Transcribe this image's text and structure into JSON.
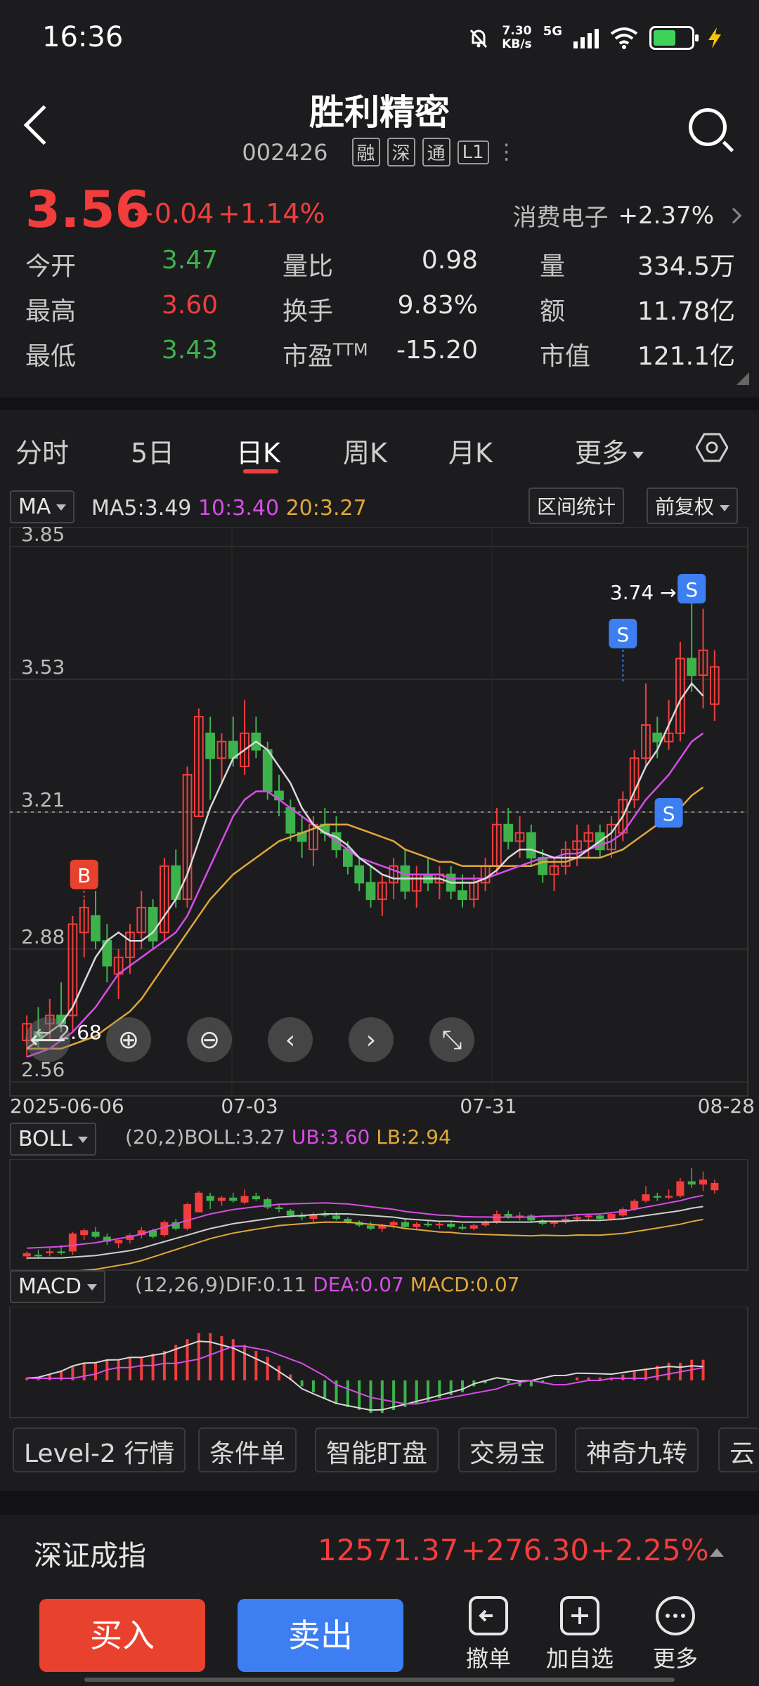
{
  "status_bar": {
    "time": "16:36",
    "net_speed": "7.30",
    "net_unit": "KB/s",
    "network": "5G"
  },
  "header": {
    "title": "胜利精密",
    "code": "002426",
    "tags": [
      "融",
      "深",
      "通",
      "L1"
    ]
  },
  "quote": {
    "price": "3.56",
    "change": "+0.04",
    "change_pct": "+1.14%",
    "sector_name": "消费电子",
    "sector_change": "+2.37%",
    "rows": [
      [
        {
          "label": "今开",
          "value": "3.47",
          "color": "green"
        },
        {
          "label": "量比",
          "value": "0.98",
          "color": "white"
        },
        {
          "label": "量",
          "value": "334.5万",
          "color": "white"
        }
      ],
      [
        {
          "label": "最高",
          "value": "3.60",
          "color": "red"
        },
        {
          "label": "换手",
          "value": "9.83%",
          "color": "white"
        },
        {
          "label": "额",
          "value": "11.78亿",
          "color": "white"
        }
      ],
      [
        {
          "label": "最低",
          "value": "3.43",
          "color": "green"
        },
        {
          "label": "市盈TTM",
          "value": "-15.20",
          "color": "white"
        },
        {
          "label": "市值",
          "value": "121.1亿",
          "color": "white"
        }
      ]
    ],
    "pe_label_main": "市盈",
    "pe_label_sup": "TTM"
  },
  "tabs": {
    "items": [
      "分时",
      "5日",
      "日K",
      "周K",
      "月K"
    ],
    "active": "日K",
    "more": "更多"
  },
  "ma_bar": {
    "indicator": "MA",
    "ma5": "MA5:3.49",
    "ma10": "10:3.40",
    "ma20": "20:3.27",
    "range_stats": "区间统计",
    "adjust": "前复权"
  },
  "colors": {
    "up": "#f23d3d",
    "down": "#3db24b",
    "ma5": "#d9d9d9",
    "ma10": "#d64ee6",
    "ma20": "#e0a83a",
    "accent": "#3d7ef2"
  },
  "chart_data": {
    "type": "candlestick",
    "y_ticks": [
      "3.85",
      "3.53",
      "3.21",
      "2.88",
      "2.56"
    ],
    "ylim": [
      2.56,
      3.85
    ],
    "x_ticks": [
      "2025-06-06",
      "07-03",
      "07-31",
      "08-28"
    ],
    "high_marker": "3.74",
    "low_marker": "2.68",
    "reference_line": 3.21,
    "markers": [
      {
        "label": "B",
        "index": 5
      },
      {
        "label": "S",
        "index": 52
      },
      {
        "label": "S",
        "index": 58
      },
      {
        "label": "S",
        "index": 57
      }
    ],
    "candles": [
      {
        "o": 2.66,
        "h": 2.72,
        "l": 2.62,
        "c": 2.7
      },
      {
        "o": 2.68,
        "h": 2.74,
        "l": 2.64,
        "c": 2.66
      },
      {
        "o": 2.7,
        "h": 2.76,
        "l": 2.66,
        "c": 2.72
      },
      {
        "o": 2.72,
        "h": 2.8,
        "l": 2.68,
        "c": 2.7
      },
      {
        "o": 2.72,
        "h": 2.96,
        "l": 2.68,
        "c": 2.94
      },
      {
        "o": 2.92,
        "h": 3.0,
        "l": 2.86,
        "c": 2.98
      },
      {
        "o": 2.96,
        "h": 3.02,
        "l": 2.88,
        "c": 2.9
      },
      {
        "o": 2.9,
        "h": 2.94,
        "l": 2.8,
        "c": 2.84
      },
      {
        "o": 2.82,
        "h": 2.88,
        "l": 2.76,
        "c": 2.86
      },
      {
        "o": 2.86,
        "h": 2.94,
        "l": 2.82,
        "c": 2.92
      },
      {
        "o": 2.92,
        "h": 3.02,
        "l": 2.88,
        "c": 2.98
      },
      {
        "o": 2.98,
        "h": 3.0,
        "l": 2.88,
        "c": 2.9
      },
      {
        "o": 2.92,
        "h": 3.1,
        "l": 2.9,
        "c": 3.08
      },
      {
        "o": 3.08,
        "h": 3.12,
        "l": 2.98,
        "c": 3.0
      },
      {
        "o": 3.0,
        "h": 3.32,
        "l": 2.98,
        "c": 3.3
      },
      {
        "o": 3.2,
        "h": 3.46,
        "l": 3.2,
        "c": 3.44
      },
      {
        "o": 3.4,
        "h": 3.44,
        "l": 3.24,
        "c": 3.34
      },
      {
        "o": 3.34,
        "h": 3.4,
        "l": 3.28,
        "c": 3.38
      },
      {
        "o": 3.38,
        "h": 3.44,
        "l": 3.32,
        "c": 3.34
      },
      {
        "o": 3.32,
        "h": 3.48,
        "l": 3.3,
        "c": 3.4
      },
      {
        "o": 3.4,
        "h": 3.44,
        "l": 3.34,
        "c": 3.36
      },
      {
        "o": 3.36,
        "h": 3.38,
        "l": 3.24,
        "c": 3.26
      },
      {
        "o": 3.26,
        "h": 3.3,
        "l": 3.2,
        "c": 3.24
      },
      {
        "o": 3.22,
        "h": 3.24,
        "l": 3.14,
        "c": 3.16
      },
      {
        "o": 3.16,
        "h": 3.2,
        "l": 3.1,
        "c": 3.14
      },
      {
        "o": 3.12,
        "h": 3.2,
        "l": 3.08,
        "c": 3.18
      },
      {
        "o": 3.18,
        "h": 3.22,
        "l": 3.14,
        "c": 3.16
      },
      {
        "o": 3.16,
        "h": 3.2,
        "l": 3.1,
        "c": 3.12
      },
      {
        "o": 3.12,
        "h": 3.14,
        "l": 3.06,
        "c": 3.08
      },
      {
        "o": 3.08,
        "h": 3.1,
        "l": 3.02,
        "c": 3.04
      },
      {
        "o": 3.04,
        "h": 3.08,
        "l": 2.98,
        "c": 3.0
      },
      {
        "o": 3.0,
        "h": 3.06,
        "l": 2.96,
        "c": 3.04
      },
      {
        "o": 3.04,
        "h": 3.1,
        "l": 3.0,
        "c": 3.08
      },
      {
        "o": 3.08,
        "h": 3.12,
        "l": 3.0,
        "c": 3.02
      },
      {
        "o": 3.02,
        "h": 3.08,
        "l": 2.98,
        "c": 3.06
      },
      {
        "o": 3.06,
        "h": 3.1,
        "l": 3.02,
        "c": 3.04
      },
      {
        "o": 3.04,
        "h": 3.08,
        "l": 3.0,
        "c": 3.06
      },
      {
        "o": 3.06,
        "h": 3.08,
        "l": 3.0,
        "c": 3.02
      },
      {
        "o": 3.02,
        "h": 3.06,
        "l": 2.98,
        "c": 3.0
      },
      {
        "o": 3.0,
        "h": 3.06,
        "l": 2.98,
        "c": 3.04
      },
      {
        "o": 3.04,
        "h": 3.1,
        "l": 3.02,
        "c": 3.08
      },
      {
        "o": 3.08,
        "h": 3.22,
        "l": 3.06,
        "c": 3.18
      },
      {
        "o": 3.18,
        "h": 3.22,
        "l": 3.12,
        "c": 3.14
      },
      {
        "o": 3.14,
        "h": 3.2,
        "l": 3.1,
        "c": 3.16
      },
      {
        "o": 3.16,
        "h": 3.18,
        "l": 3.08,
        "c": 3.1
      },
      {
        "o": 3.1,
        "h": 3.12,
        "l": 3.04,
        "c": 3.06
      },
      {
        "o": 3.06,
        "h": 3.1,
        "l": 3.02,
        "c": 3.08
      },
      {
        "o": 3.08,
        "h": 3.14,
        "l": 3.06,
        "c": 3.12
      },
      {
        "o": 3.12,
        "h": 3.18,
        "l": 3.08,
        "c": 3.14
      },
      {
        "o": 3.14,
        "h": 3.18,
        "l": 3.1,
        "c": 3.16
      },
      {
        "o": 3.16,
        "h": 3.18,
        "l": 3.1,
        "c": 3.12
      },
      {
        "o": 3.12,
        "h": 3.2,
        "l": 3.1,
        "c": 3.18
      },
      {
        "o": 3.16,
        "h": 3.26,
        "l": 3.14,
        "c": 3.24
      },
      {
        "o": 3.24,
        "h": 3.36,
        "l": 3.22,
        "c": 3.34
      },
      {
        "o": 3.34,
        "h": 3.52,
        "l": 3.32,
        "c": 3.42
      },
      {
        "o": 3.4,
        "h": 3.44,
        "l": 3.34,
        "c": 3.38
      },
      {
        "o": 3.38,
        "h": 3.48,
        "l": 3.36,
        "c": 3.4
      },
      {
        "o": 3.4,
        "h": 3.62,
        "l": 3.38,
        "c": 3.58
      },
      {
        "o": 3.58,
        "h": 3.74,
        "l": 3.5,
        "c": 3.54
      },
      {
        "o": 3.54,
        "h": 3.7,
        "l": 3.46,
        "c": 3.6
      },
      {
        "o": 3.47,
        "h": 3.6,
        "l": 3.43,
        "c": 3.56
      }
    ],
    "ma5": [
      2.64,
      2.66,
      2.68,
      2.7,
      2.74,
      2.8,
      2.86,
      2.9,
      2.92,
      2.9,
      2.9,
      2.92,
      2.96,
      3.0,
      3.06,
      3.14,
      3.22,
      3.28,
      3.34,
      3.36,
      3.38,
      3.36,
      3.32,
      3.28,
      3.22,
      3.18,
      3.16,
      3.15,
      3.13,
      3.1,
      3.08,
      3.06,
      3.05,
      3.05,
      3.05,
      3.05,
      3.05,
      3.04,
      3.04,
      3.04,
      3.05,
      3.07,
      3.1,
      3.12,
      3.12,
      3.11,
      3.1,
      3.1,
      3.1,
      3.12,
      3.14,
      3.16,
      3.2,
      3.26,
      3.32,
      3.36,
      3.42,
      3.48,
      3.52,
      3.49
    ],
    "ma10": [
      2.62,
      2.63,
      2.64,
      2.66,
      2.68,
      2.71,
      2.74,
      2.78,
      2.82,
      2.84,
      2.86,
      2.88,
      2.9,
      2.92,
      2.96,
      3.02,
      3.08,
      3.14,
      3.2,
      3.24,
      3.26,
      3.26,
      3.24,
      3.22,
      3.2,
      3.18,
      3.16,
      3.14,
      3.12,
      3.1,
      3.09,
      3.08,
      3.07,
      3.06,
      3.06,
      3.06,
      3.06,
      3.05,
      3.05,
      3.05,
      3.05,
      3.06,
      3.07,
      3.08,
      3.09,
      3.1,
      3.1,
      3.11,
      3.11,
      3.12,
      3.13,
      3.14,
      3.16,
      3.2,
      3.24,
      3.27,
      3.3,
      3.34,
      3.38,
      3.4
    ],
    "ma20": [
      2.64,
      2.64,
      2.64,
      2.64,
      2.65,
      2.66,
      2.67,
      2.69,
      2.71,
      2.73,
      2.76,
      2.8,
      2.84,
      2.88,
      2.92,
      2.96,
      3.0,
      3.03,
      3.06,
      3.08,
      3.1,
      3.12,
      3.14,
      3.15,
      3.16,
      3.17,
      3.18,
      3.18,
      3.18,
      3.17,
      3.16,
      3.15,
      3.14,
      3.12,
      3.11,
      3.1,
      3.09,
      3.09,
      3.08,
      3.08,
      3.08,
      3.08,
      3.08,
      3.08,
      3.08,
      3.09,
      3.09,
      3.09,
      3.1,
      3.1,
      3.1,
      3.11,
      3.12,
      3.14,
      3.16,
      3.18,
      3.2,
      3.22,
      3.25,
      3.27
    ]
  },
  "boll_bar": {
    "indicator": "BOLL",
    "params": "(20,2)BOLL:3.27",
    "ub": "UB:3.60",
    "lb": "LB:2.94"
  },
  "macd_bar": {
    "indicator": "MACD",
    "params": "(12,26,9)DIF:0.11",
    "dea": "DEA:0.07",
    "macd": "MACD:0.07"
  },
  "macd_hist": [
    0.01,
    0.01,
    0.02,
    0.03,
    0.05,
    0.06,
    0.06,
    0.07,
    0.07,
    0.08,
    0.08,
    0.09,
    0.1,
    0.12,
    0.14,
    0.16,
    0.16,
    0.15,
    0.14,
    0.12,
    0.1,
    0.08,
    0.05,
    0.02,
    -0.02,
    -0.04,
    -0.06,
    -0.08,
    -0.09,
    -0.1,
    -0.11,
    -0.11,
    -0.1,
    -0.09,
    -0.08,
    -0.07,
    -0.06,
    -0.05,
    -0.04,
    -0.02,
    -0.01,
    0.0,
    -0.01,
    -0.02,
    -0.02,
    -0.01,
    0.0,
    0.0,
    0.01,
    0.01,
    0.01,
    0.01,
    0.02,
    0.03,
    0.04,
    0.05,
    0.06,
    0.06,
    0.07,
    0.07
  ],
  "tools": [
    "Level-2 行情",
    "条件单",
    "智能盯盘",
    "交易宝",
    "神奇九转",
    "云"
  ],
  "index_bar": {
    "name": "深证成指",
    "value": "12571.37",
    "change": "+276.30",
    "change_pct": "+2.25%"
  },
  "actions": {
    "buy": "买入",
    "sell": "卖出",
    "cancel": "撤单",
    "watchlist": "加自选",
    "more": "更多"
  }
}
